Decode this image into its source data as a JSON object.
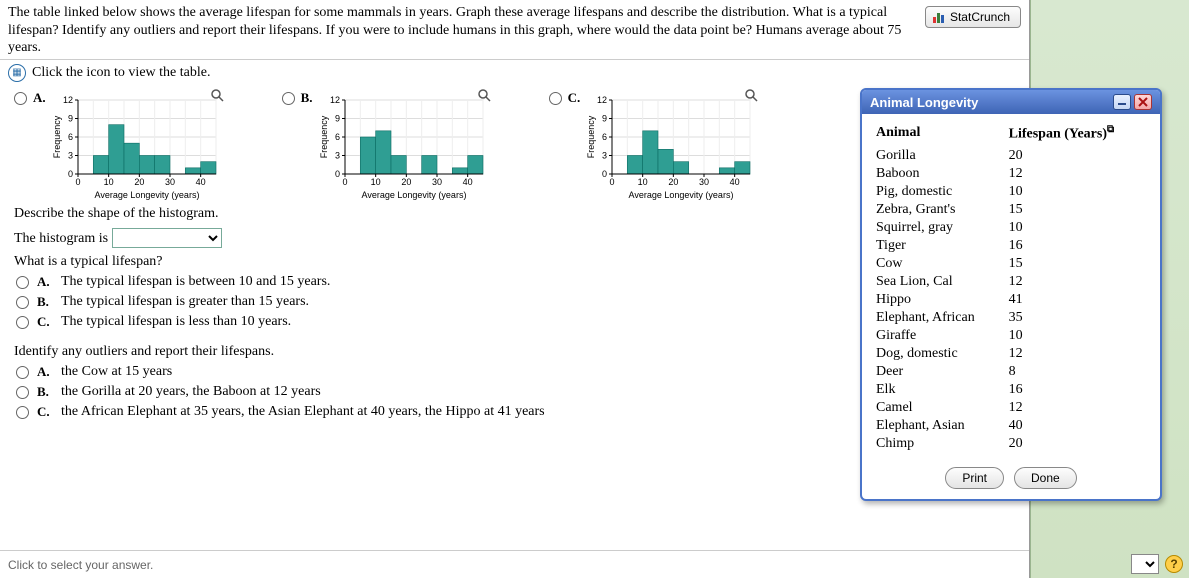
{
  "question": {
    "prompt": "The table linked below shows the average lifespan for some mammals in years. Graph these average lifespans and describe the distribution. What is a typical lifespan? Identify any outliers and report their lifespans. If you were to include humans in this graph, where would the data point be? Humans average about 75 years.",
    "table_link": "Click the icon to view the table."
  },
  "statcrunch_label": "StatCrunch",
  "hist_options": {
    "a": "A.",
    "b": "B.",
    "c": "C."
  },
  "axes": {
    "ylabel": "Frequency",
    "xlabel": "Average Longevity (years)",
    "xticks": [
      "0",
      "10",
      "20",
      "30",
      "40"
    ],
    "yticks": [
      "0",
      "3",
      "6",
      "9",
      "12"
    ]
  },
  "chart_data": [
    {
      "type": "bar",
      "option": "A",
      "categories": [
        2.5,
        7.5,
        12.5,
        17.5,
        22.5,
        27.5,
        32.5,
        37.5,
        42.5
      ],
      "values": [
        0,
        3,
        8,
        5,
        3,
        3,
        0,
        1,
        2
      ],
      "xlabel": "Average Longevity (years)",
      "ylabel": "Frequency",
      "xlim": [
        0,
        45
      ],
      "ylim": [
        0,
        12
      ]
    },
    {
      "type": "bar",
      "option": "B",
      "categories": [
        2.5,
        7.5,
        12.5,
        17.5,
        22.5,
        27.5,
        32.5,
        37.5,
        42.5
      ],
      "values": [
        0,
        6,
        7,
        3,
        0,
        3,
        0,
        1,
        3
      ],
      "xlabel": "Average Longevity (years)",
      "ylabel": "Frequency",
      "xlim": [
        0,
        45
      ],
      "ylim": [
        0,
        12
      ]
    },
    {
      "type": "bar",
      "option": "C",
      "categories": [
        2.5,
        7.5,
        12.5,
        17.5,
        22.5,
        27.5,
        32.5,
        37.5,
        42.5
      ],
      "values": [
        0,
        3,
        7,
        4,
        2,
        0,
        0,
        1,
        2
      ],
      "xlabel": "Average Longevity (years)",
      "ylabel": "Frequency",
      "xlim": [
        0,
        45
      ],
      "ylim": [
        0,
        12
      ]
    }
  ],
  "q_shape": {
    "prompt": "Describe the shape of the histogram.",
    "lead": "The histogram is"
  },
  "q_typical": {
    "prompt": "What is a typical lifespan?",
    "opts": {
      "a_label": "A.",
      "a": "The typical lifespan is between 10 and 15 years.",
      "b_label": "B.",
      "b": "The typical lifespan is greater than 15 years.",
      "c_label": "C.",
      "c": "The typical lifespan is less than 10 years."
    }
  },
  "q_outliers": {
    "prompt": "Identify any outliers and report their lifespans.",
    "opts": {
      "a_label": "A.",
      "a": "the Cow at 15 years",
      "b_label": "B.",
      "b": "the Gorilla at 20 years, the Baboon at 12 years",
      "c_label": "C.",
      "c": "the African Elephant at 35 years, the Asian Elephant at 40 years, the Hippo at 41 years"
    }
  },
  "footer_text": "Click to select your answer.",
  "popup": {
    "title": "Animal Longevity",
    "col1": "Animal",
    "col2": "Lifespan (Years)",
    "rows": [
      {
        "a": "Gorilla",
        "v": "20"
      },
      {
        "a": "Baboon",
        "v": "12"
      },
      {
        "a": "Pig, domestic",
        "v": "10"
      },
      {
        "a": "Zebra, Grant's",
        "v": "15"
      },
      {
        "a": "Squirrel, gray",
        "v": "10"
      },
      {
        "a": "Tiger",
        "v": "16"
      },
      {
        "a": "Cow",
        "v": "15"
      },
      {
        "a": "Sea Lion, Cal",
        "v": "12"
      },
      {
        "a": "Hippo",
        "v": "41"
      },
      {
        "a": "Elephant, African",
        "v": "35"
      },
      {
        "a": "Giraffe",
        "v": "10"
      },
      {
        "a": "Dog, domestic",
        "v": "12"
      },
      {
        "a": "Deer",
        "v": "8"
      },
      {
        "a": "Elk",
        "v": "16"
      },
      {
        "a": "Camel",
        "v": "12"
      },
      {
        "a": "Elephant, Asian",
        "v": "40"
      },
      {
        "a": "Chimp",
        "v": "20"
      }
    ],
    "print": "Print",
    "done": "Done"
  }
}
